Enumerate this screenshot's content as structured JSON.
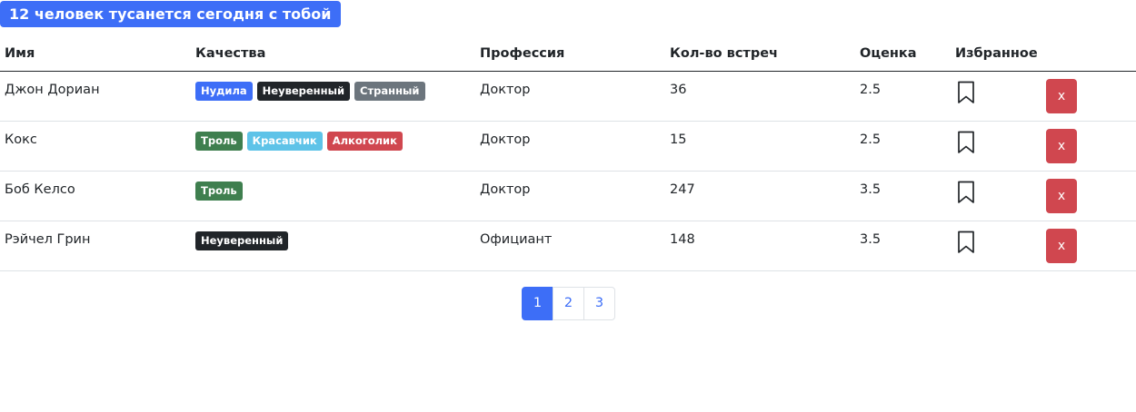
{
  "header": {
    "count_text": "12 человек тусанется сегодня с тобой"
  },
  "table": {
    "columns": [
      "Имя",
      "Качества",
      "Профессия",
      "Кол-во встреч",
      "Оценка",
      "Избранное"
    ],
    "rows": [
      {
        "name": "Джон Дориан",
        "qualities": [
          {
            "label": "Нудила",
            "color": "#3d6ef7"
          },
          {
            "label": "Неуверенный",
            "color": "#212529"
          },
          {
            "label": "Странный",
            "color": "#6c757d"
          }
        ],
        "profession": "Доктор",
        "meetings": "36",
        "rate": "2.5",
        "favorite_icon": "bookmark-outline-icon",
        "delete_label": "x"
      },
      {
        "name": "Кокс",
        "qualities": [
          {
            "label": "Троль",
            "color": "#3f7f4f"
          },
          {
            "label": "Красавчик",
            "color": "#5ec3e8"
          },
          {
            "label": "Алкоголик",
            "color": "#d0474f"
          }
        ],
        "profession": "Доктор",
        "meetings": "15",
        "rate": "2.5",
        "favorite_icon": "bookmark-outline-icon",
        "delete_label": "x"
      },
      {
        "name": "Боб Келсо",
        "qualities": [
          {
            "label": "Троль",
            "color": "#3f7f4f"
          }
        ],
        "profession": "Доктор",
        "meetings": "247",
        "rate": "3.5",
        "favorite_icon": "bookmark-outline-icon",
        "delete_label": "x"
      },
      {
        "name": "Рэйчел Грин",
        "qualities": [
          {
            "label": "Неуверенный",
            "color": "#212529"
          }
        ],
        "profession": "Официант",
        "meetings": "148",
        "rate": "3.5",
        "favorite_icon": "bookmark-outline-icon",
        "delete_label": "x"
      }
    ]
  },
  "pagination": {
    "pages": [
      "1",
      "2",
      "3"
    ],
    "active": "1",
    "accent_color": "#3d6ef7"
  }
}
